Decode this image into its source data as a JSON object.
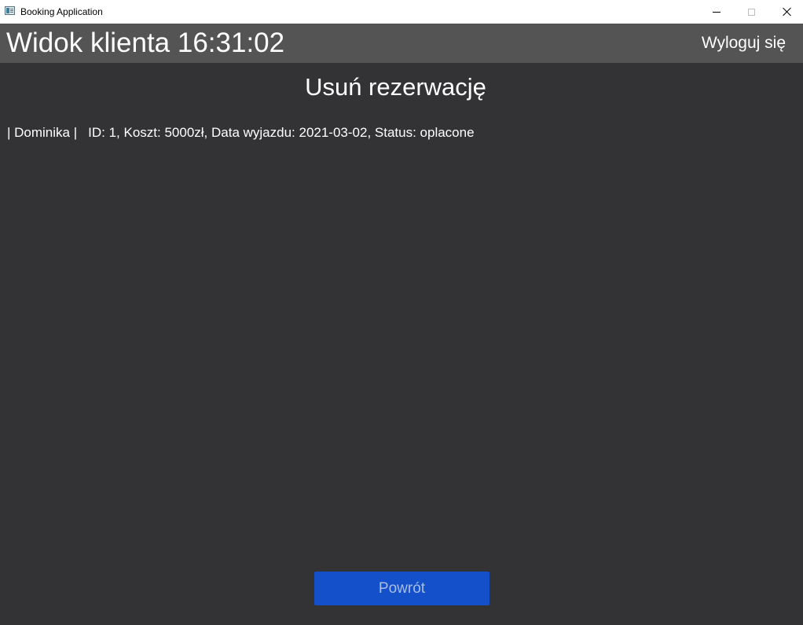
{
  "window": {
    "title": "Booking Application",
    "icon": "app-window-icon"
  },
  "header": {
    "title": "Widok klienta 16:31:02",
    "logout_label": "Wyloguj się"
  },
  "page": {
    "heading": "Usuń rezerwację"
  },
  "reservations": [
    {
      "user": "| Dominika |",
      "details": "ID: 1, Koszt: 5000zł, Data wyjazdu: 2021-03-02, Status: oplacone"
    }
  ],
  "footer": {
    "back_label": "Powrót"
  },
  "colors": {
    "background": "#333235",
    "header": "#545454",
    "button": "#1350c9",
    "button_text": "#a9bde6"
  }
}
